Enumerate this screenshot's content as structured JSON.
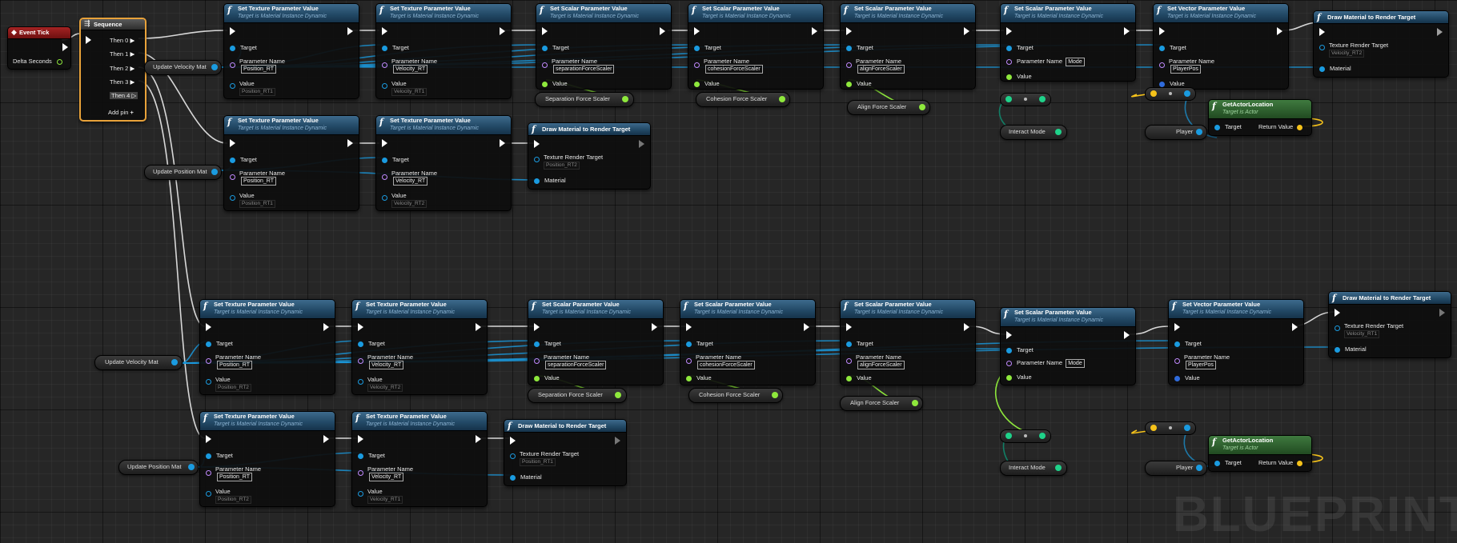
{
  "watermark": "BLUEPRINT",
  "event_tick": {
    "title": "Event Tick",
    "delta": "Delta Seconds"
  },
  "sequence": {
    "title": "Sequence",
    "outputs": [
      "Then 0",
      "Then 1",
      "Then 2",
      "Then 3",
      "Then 4"
    ],
    "add_pin": "Add pin"
  },
  "labels": {
    "target": "Target",
    "param_name": "Parameter Name",
    "value": "Value",
    "texture_rt": "Texture Render Target",
    "material": "Material",
    "return_value": "Return Value"
  },
  "subtitles": {
    "mid": "Target is Material Instance Dynamic",
    "actor": "Target is Actor"
  },
  "titles": {
    "set_tex": "Set Texture Parameter Value",
    "set_scalar": "Set Scalar Parameter Value",
    "set_vector": "Set Vector Parameter Value",
    "draw_mat": "Draw Material to Render Target",
    "get_actor_loc": "GetActorLocation"
  },
  "params": {
    "position_rt": "Position_RT",
    "velocity_rt": "Velocity_RT",
    "separation": "separationForceScaler",
    "cohesion": "cohesionForceScaler",
    "align": "alignForceScaler",
    "mode": "Mode",
    "player_pos": "PlayerPos"
  },
  "rt_values": {
    "pos1": "Position_RT1",
    "vel1": "Velocity_RT1",
    "pos2": "Position_RT2",
    "vel2": "Velocity_RT2"
  },
  "vars": {
    "update_velocity_mat": "Update Velocity Mat",
    "update_position_mat": "Update Position Mat",
    "separation_force_scaler": "Separation Force Scaler",
    "cohesion_force_scaler": "Cohesion Force Scaler",
    "align_force_scaler": "Align Force Scaler",
    "interact_mode": "Interact Mode",
    "player": "Player"
  },
  "colors": {
    "exec": "#ffffff",
    "object": "#1a9be0",
    "name": "#c18aff",
    "float": "#8ee83c",
    "vector": "#f5c21a",
    "byte": "#0f8a6e",
    "event": "#a52323",
    "sequence_border": "#e8a23a"
  }
}
